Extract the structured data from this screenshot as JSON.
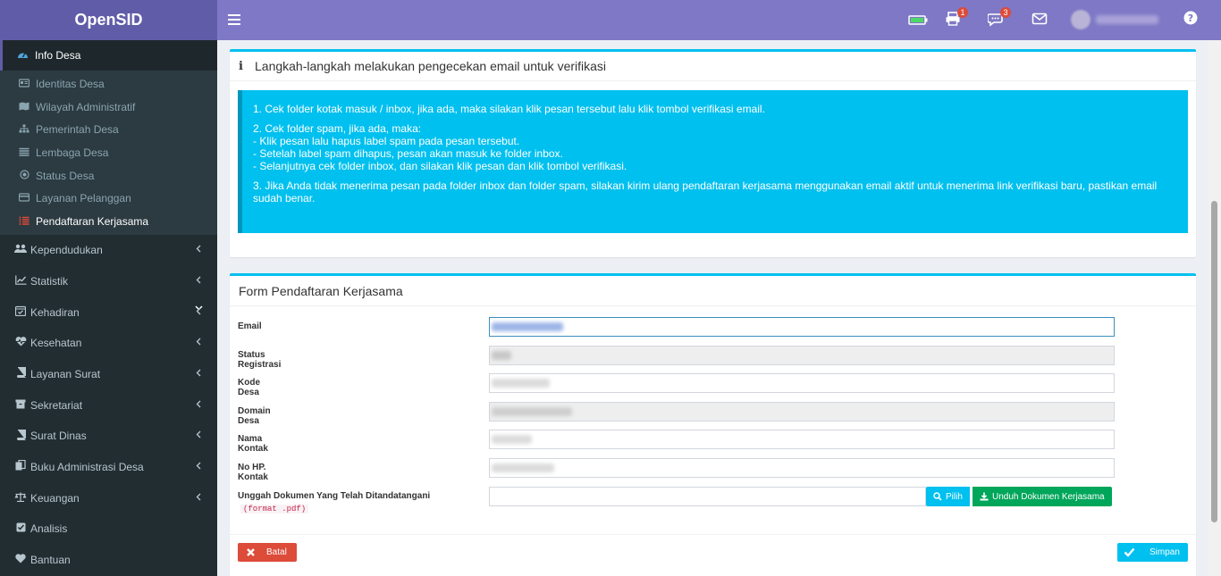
{
  "app": {
    "brand": "OpenSID"
  },
  "topbar": {
    "printer_badge": "1",
    "chat_badge": "3"
  },
  "sidebar": {
    "active_group": "Info Desa",
    "sub_items": [
      {
        "label": "Identitas Desa",
        "icon": "id-card-icon"
      },
      {
        "label": "Wilayah Administratif",
        "icon": "map-icon"
      },
      {
        "label": "Pemerintah Desa",
        "icon": "sitemap-icon"
      },
      {
        "label": "Lembaga Desa",
        "icon": "list-icon"
      },
      {
        "label": "Status Desa",
        "icon": "dot-circle-icon"
      },
      {
        "label": "Layanan Pelanggan",
        "icon": "credit-card-icon"
      },
      {
        "label": "Pendaftaran Kerjasama",
        "icon": "list-alt-icon"
      }
    ],
    "items": [
      {
        "label": "Kependudukan",
        "icon": "users-icon"
      },
      {
        "label": "Statistik",
        "icon": "line-chart-icon"
      },
      {
        "label": "Kehadiran",
        "icon": "calendar-check-icon"
      },
      {
        "label": "Kesehatan",
        "icon": "heartbeat-icon"
      },
      {
        "label": "Layanan Surat",
        "icon": "book-icon"
      },
      {
        "label": "Sekretariat",
        "icon": "archive-icon"
      },
      {
        "label": "Surat Dinas",
        "icon": "book-icon"
      },
      {
        "label": "Buku Administrasi Desa",
        "icon": "copy-icon"
      },
      {
        "label": "Keuangan",
        "icon": "balance-scale-icon"
      },
      {
        "label": "Analisis",
        "icon": "check-square-icon"
      },
      {
        "label": "Bantuan",
        "icon": "heart-icon"
      }
    ]
  },
  "info_box": {
    "title": "Langkah-langkah melakukan pengecekan email untuk verifikasi",
    "step1": "1. Cek folder kotak masuk / inbox, jika ada, maka silakan klik pesan tersebut lalu klik tombol verifikasi email.",
    "step2_head": "2. Cek folder spam, jika ada, maka:",
    "step2_a": "- Klik pesan lalu hapus label spam pada pesan tersebut.",
    "step2_b": "- Setelah label spam dihapus, pesan akan masuk ke folder inbox.",
    "step2_c": "- Selanjutnya cek folder inbox, dan silakan klik pesan dan klik tombol verifikasi.",
    "step3": "3. Jika Anda tidak menerima pesan pada folder inbox dan folder spam, silakan kirim ulang pendaftaran kerjasama menggunakan email aktif untuk menerima link verifikasi baru, pastikan email sudah benar."
  },
  "form": {
    "title": "Form Pendaftaran Kerjasama",
    "labels": {
      "email": "Email",
      "status": "Status Registrasi",
      "kode": "Kode Desa",
      "domain": "Domain Desa",
      "nama": "Nama Kontak",
      "hp": "No HP. Kontak",
      "unggah": "Unggah Dokumen Yang Telah Ditandatangani",
      "format": "(format .pdf)"
    },
    "buttons": {
      "pilih": "Pilih",
      "unduh": "Unduh Dokumen Kerjasama",
      "batal": "Batal",
      "simpan": "Simpan"
    }
  }
}
